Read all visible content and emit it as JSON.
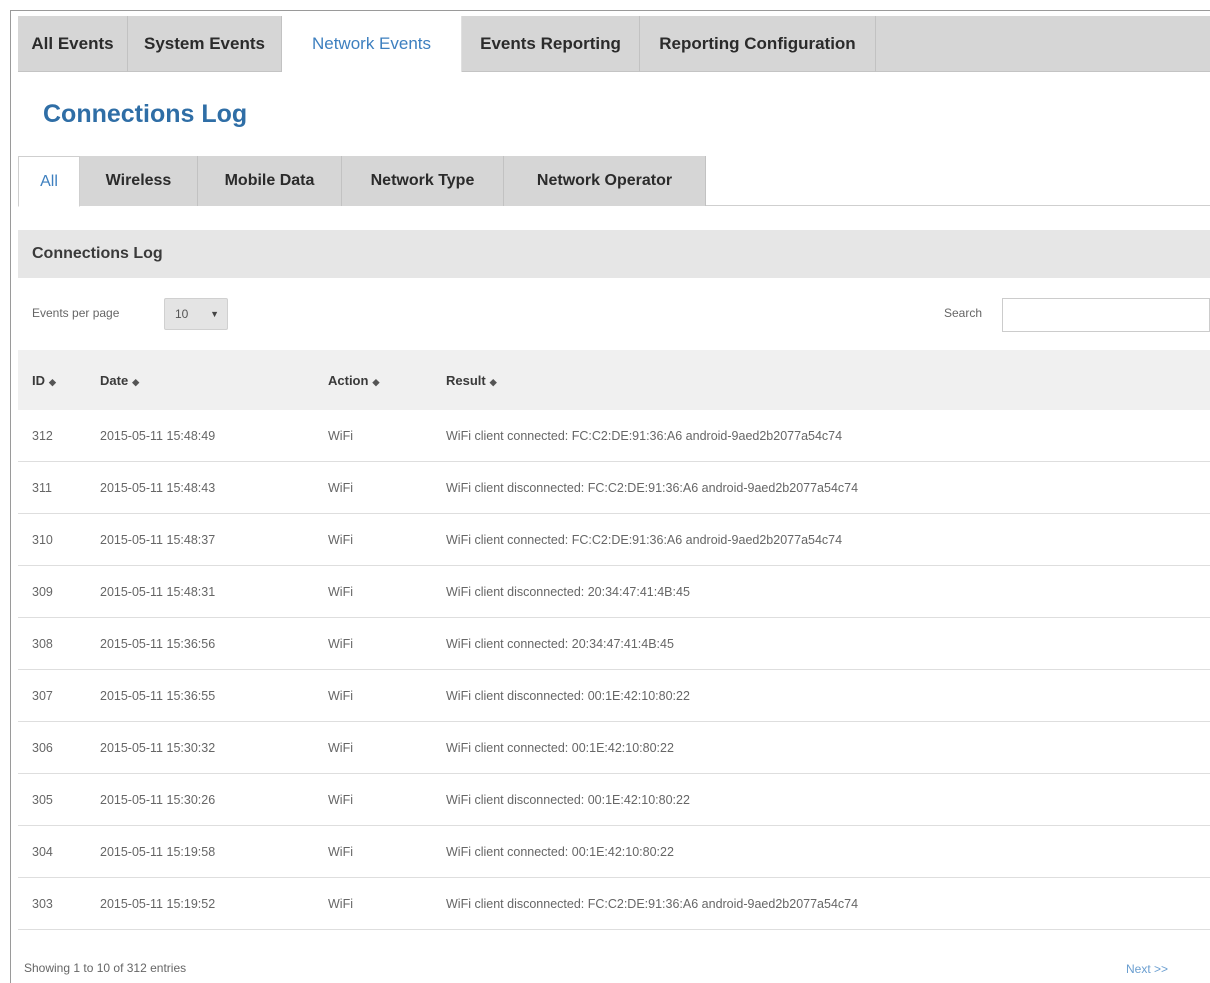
{
  "top_tabs": [
    {
      "label": "All Events"
    },
    {
      "label": "System Events"
    },
    {
      "label": "Network Events",
      "active": true
    },
    {
      "label": "Events Reporting"
    },
    {
      "label": "Reporting Configuration"
    }
  ],
  "page_title": "Connections Log",
  "sub_tabs": [
    {
      "label": "All",
      "active": true
    },
    {
      "label": "Wireless"
    },
    {
      "label": "Mobile Data"
    },
    {
      "label": "Network Type"
    },
    {
      "label": "Network Operator"
    }
  ],
  "section_title": "Connections Log",
  "controls": {
    "events_per_page_label": "Events per page",
    "events_per_page_value": "10",
    "search_label": "Search",
    "search_value": ""
  },
  "table": {
    "columns": [
      "ID",
      "Date",
      "Action",
      "Result"
    ],
    "sort_icon": "◆",
    "rows": [
      {
        "id": "312",
        "date": "2015-05-11 15:48:49",
        "action": "WiFi",
        "result": "WiFi client connected: FC:C2:DE:91:36:A6 android-9aed2b2077a54c74"
      },
      {
        "id": "311",
        "date": "2015-05-11 15:48:43",
        "action": "WiFi",
        "result": "WiFi client disconnected: FC:C2:DE:91:36:A6 android-9aed2b2077a54c74"
      },
      {
        "id": "310",
        "date": "2015-05-11 15:48:37",
        "action": "WiFi",
        "result": "WiFi client connected: FC:C2:DE:91:36:A6 android-9aed2b2077a54c74"
      },
      {
        "id": "309",
        "date": "2015-05-11 15:48:31",
        "action": "WiFi",
        "result": "WiFi client disconnected: 20:34:47:41:4B:45"
      },
      {
        "id": "308",
        "date": "2015-05-11 15:36:56",
        "action": "WiFi",
        "result": "WiFi client connected: 20:34:47:41:4B:45"
      },
      {
        "id": "307",
        "date": "2015-05-11 15:36:55",
        "action": "WiFi",
        "result": "WiFi client disconnected: 00:1E:42:10:80:22"
      },
      {
        "id": "306",
        "date": "2015-05-11 15:30:32",
        "action": "WiFi",
        "result": "WiFi client connected: 00:1E:42:10:80:22"
      },
      {
        "id": "305",
        "date": "2015-05-11 15:30:26",
        "action": "WiFi",
        "result": "WiFi client disconnected: 00:1E:42:10:80:22"
      },
      {
        "id": "304",
        "date": "2015-05-11 15:19:58",
        "action": "WiFi",
        "result": "WiFi client connected: 00:1E:42:10:80:22"
      },
      {
        "id": "303",
        "date": "2015-05-11 15:19:52",
        "action": "WiFi",
        "result": "WiFi client disconnected: FC:C2:DE:91:36:A6 android-9aed2b2077a54c74"
      }
    ]
  },
  "footer": {
    "info": "Showing 1 to 10 of 312 entries",
    "next_label": "Next >>"
  }
}
